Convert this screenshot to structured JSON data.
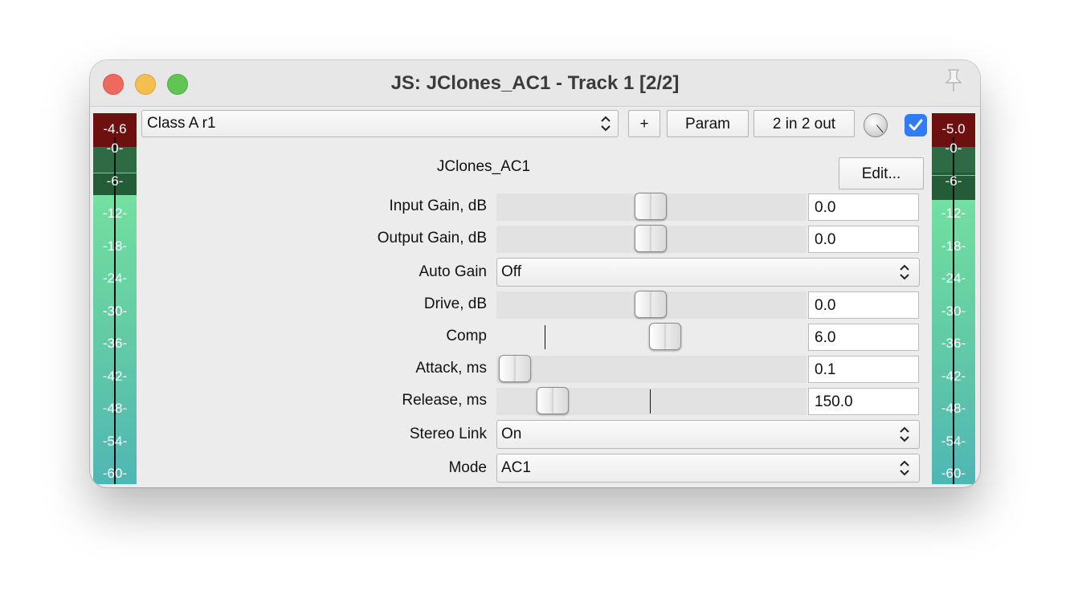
{
  "window": {
    "title": "JS: JClones_AC1 - Track 1 [2/2]"
  },
  "meters": {
    "left_peak": "-4.6",
    "right_peak": "-5.0",
    "scale": [
      "-0-",
      "-6-",
      "-12-",
      "-18-",
      "-24-",
      "-30-",
      "-36-",
      "-42-",
      "-48-",
      "-54-",
      "-60-"
    ]
  },
  "toolbar": {
    "preset": "Class A r1",
    "add_label": "+",
    "param_label": "Param",
    "io_label": "2 in 2 out",
    "enabled": true
  },
  "fx": {
    "name": "JClones_AC1",
    "edit_label": "Edit..."
  },
  "params": [
    {
      "label": "Input Gain, dB",
      "kind": "slider",
      "value": "0.0",
      "position": 0.5
    },
    {
      "label": "Output Gain, dB",
      "kind": "slider",
      "value": "0.0",
      "position": 0.5
    },
    {
      "label": "Auto Gain",
      "kind": "select",
      "value": "Off"
    },
    {
      "label": "Drive, dB",
      "kind": "slider",
      "value": "0.0",
      "position": 0.5
    },
    {
      "label": "Comp",
      "kind": "slider",
      "value": "6.0",
      "position": 0.545
    },
    {
      "label": "Attack, ms",
      "kind": "slider",
      "value": "0.1",
      "position": 0.0
    },
    {
      "label": "Release, ms",
      "kind": "slider",
      "value": "150.0",
      "position": 0.13
    },
    {
      "label": "Stereo Link",
      "kind": "select",
      "value": "On"
    },
    {
      "label": "Mode",
      "kind": "select",
      "value": "AC1"
    }
  ]
}
